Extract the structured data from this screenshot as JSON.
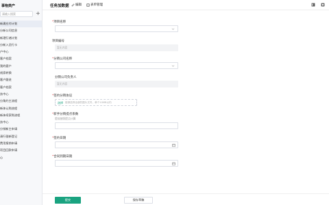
{
  "sidebar": {
    "brand": "事物类产",
    "search_placeholder": "请输入搜索",
    "items": [
      {
        "label": "新建应付计划",
        "active": true
      },
      {
        "label": "分新公司信息",
        "active": false
      },
      {
        "label": "新理行诸计划",
        "active": false
      },
      {
        "label": "分新入员行卡",
        "active": false
      },
      {
        "label": "户中心",
        "active": false,
        "section": true
      },
      {
        "label": "客户档案",
        "active": false
      },
      {
        "label": "我的客户",
        "active": false
      },
      {
        "label": "线索转换",
        "active": false
      },
      {
        "label": "客户跟进",
        "active": false
      },
      {
        "label": "客户档案",
        "active": false
      },
      {
        "label": "务中心",
        "active": false,
        "section": true
      },
      {
        "label": "分角约主流程",
        "active": false
      },
      {
        "label": "新体认购流程",
        "active": false
      },
      {
        "label": "新体续家购流程",
        "active": false
      },
      {
        "label": "务中心",
        "active": false,
        "section": true
      },
      {
        "label": "分销新主申请",
        "active": false
      },
      {
        "label": "请行银新登记",
        "active": false
      },
      {
        "label": "费用报销申请",
        "active": false
      },
      {
        "label": "项目回款申请",
        "active": false
      },
      {
        "label": "心",
        "active": false,
        "section": true
      }
    ]
  },
  "topbar": {
    "title": "任务加数据",
    "edit_label": "编辑",
    "manage_label": "表单管理"
  },
  "form": {
    "project_name_label": "项目名称",
    "project_no_label": "项目编号",
    "project_no_placeholder": "暂无内容",
    "company_name_label": "分销公司名称",
    "company_contact_label": "分销公司负责人",
    "company_contact_placeholder": "暂无内容",
    "agreement_label": "签约分销协议",
    "upload_button": "选择",
    "upload_tip": "能够选择全部的图片文件，单个10MB以内",
    "rate_label": "新手分销提点系数",
    "rate_hint": "提成按照提点计算",
    "sign_date_label": "签约日期",
    "expire_date_label": "合同到期日期"
  },
  "footer": {
    "submit_label": "提交",
    "save_draft_label": "保存草稿"
  },
  "colors": {
    "accent": "#1aa380",
    "required": "#e04040"
  }
}
